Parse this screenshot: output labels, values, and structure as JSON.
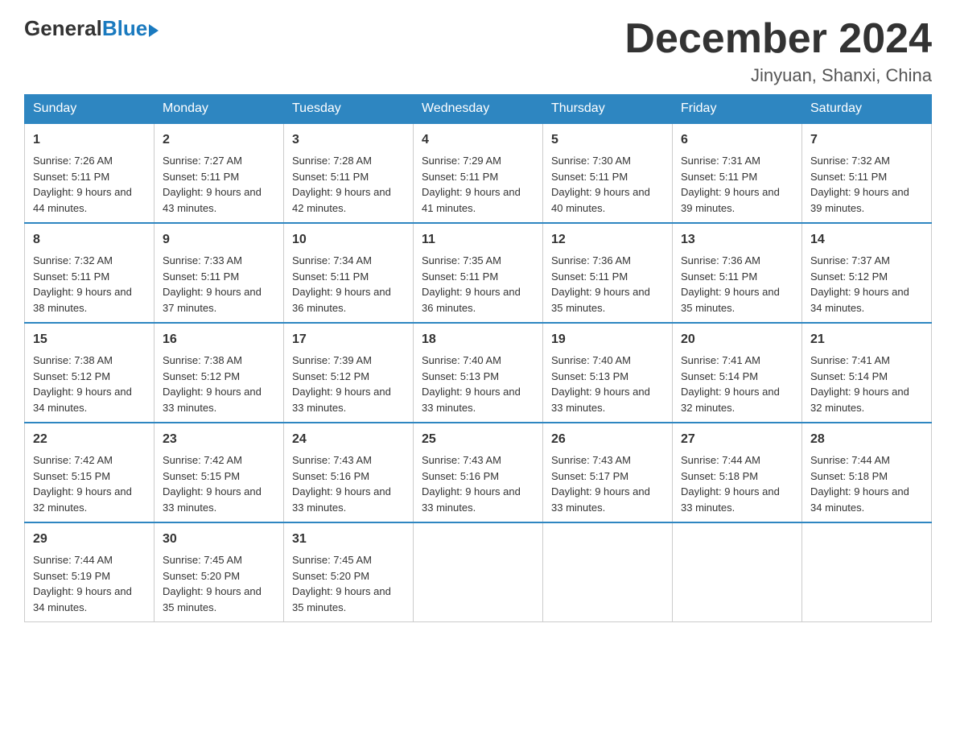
{
  "logo": {
    "general": "General",
    "blue": "Blue"
  },
  "title": "December 2024",
  "subtitle": "Jinyuan, Shanxi, China",
  "days": [
    "Sunday",
    "Monday",
    "Tuesday",
    "Wednesday",
    "Thursday",
    "Friday",
    "Saturday"
  ],
  "weeks": [
    [
      {
        "num": "1",
        "sunrise": "7:26 AM",
        "sunset": "5:11 PM",
        "daylight": "9 hours and 44 minutes."
      },
      {
        "num": "2",
        "sunrise": "7:27 AM",
        "sunset": "5:11 PM",
        "daylight": "9 hours and 43 minutes."
      },
      {
        "num": "3",
        "sunrise": "7:28 AM",
        "sunset": "5:11 PM",
        "daylight": "9 hours and 42 minutes."
      },
      {
        "num": "4",
        "sunrise": "7:29 AM",
        "sunset": "5:11 PM",
        "daylight": "9 hours and 41 minutes."
      },
      {
        "num": "5",
        "sunrise": "7:30 AM",
        "sunset": "5:11 PM",
        "daylight": "9 hours and 40 minutes."
      },
      {
        "num": "6",
        "sunrise": "7:31 AM",
        "sunset": "5:11 PM",
        "daylight": "9 hours and 39 minutes."
      },
      {
        "num": "7",
        "sunrise": "7:32 AM",
        "sunset": "5:11 PM",
        "daylight": "9 hours and 39 minutes."
      }
    ],
    [
      {
        "num": "8",
        "sunrise": "7:32 AM",
        "sunset": "5:11 PM",
        "daylight": "9 hours and 38 minutes."
      },
      {
        "num": "9",
        "sunrise": "7:33 AM",
        "sunset": "5:11 PM",
        "daylight": "9 hours and 37 minutes."
      },
      {
        "num": "10",
        "sunrise": "7:34 AM",
        "sunset": "5:11 PM",
        "daylight": "9 hours and 36 minutes."
      },
      {
        "num": "11",
        "sunrise": "7:35 AM",
        "sunset": "5:11 PM",
        "daylight": "9 hours and 36 minutes."
      },
      {
        "num": "12",
        "sunrise": "7:36 AM",
        "sunset": "5:11 PM",
        "daylight": "9 hours and 35 minutes."
      },
      {
        "num": "13",
        "sunrise": "7:36 AM",
        "sunset": "5:11 PM",
        "daylight": "9 hours and 35 minutes."
      },
      {
        "num": "14",
        "sunrise": "7:37 AM",
        "sunset": "5:12 PM",
        "daylight": "9 hours and 34 minutes."
      }
    ],
    [
      {
        "num": "15",
        "sunrise": "7:38 AM",
        "sunset": "5:12 PM",
        "daylight": "9 hours and 34 minutes."
      },
      {
        "num": "16",
        "sunrise": "7:38 AM",
        "sunset": "5:12 PM",
        "daylight": "9 hours and 33 minutes."
      },
      {
        "num": "17",
        "sunrise": "7:39 AM",
        "sunset": "5:12 PM",
        "daylight": "9 hours and 33 minutes."
      },
      {
        "num": "18",
        "sunrise": "7:40 AM",
        "sunset": "5:13 PM",
        "daylight": "9 hours and 33 minutes."
      },
      {
        "num": "19",
        "sunrise": "7:40 AM",
        "sunset": "5:13 PM",
        "daylight": "9 hours and 33 minutes."
      },
      {
        "num": "20",
        "sunrise": "7:41 AM",
        "sunset": "5:14 PM",
        "daylight": "9 hours and 32 minutes."
      },
      {
        "num": "21",
        "sunrise": "7:41 AM",
        "sunset": "5:14 PM",
        "daylight": "9 hours and 32 minutes."
      }
    ],
    [
      {
        "num": "22",
        "sunrise": "7:42 AM",
        "sunset": "5:15 PM",
        "daylight": "9 hours and 32 minutes."
      },
      {
        "num": "23",
        "sunrise": "7:42 AM",
        "sunset": "5:15 PM",
        "daylight": "9 hours and 33 minutes."
      },
      {
        "num": "24",
        "sunrise": "7:43 AM",
        "sunset": "5:16 PM",
        "daylight": "9 hours and 33 minutes."
      },
      {
        "num": "25",
        "sunrise": "7:43 AM",
        "sunset": "5:16 PM",
        "daylight": "9 hours and 33 minutes."
      },
      {
        "num": "26",
        "sunrise": "7:43 AM",
        "sunset": "5:17 PM",
        "daylight": "9 hours and 33 minutes."
      },
      {
        "num": "27",
        "sunrise": "7:44 AM",
        "sunset": "5:18 PM",
        "daylight": "9 hours and 33 minutes."
      },
      {
        "num": "28",
        "sunrise": "7:44 AM",
        "sunset": "5:18 PM",
        "daylight": "9 hours and 34 minutes."
      }
    ],
    [
      {
        "num": "29",
        "sunrise": "7:44 AM",
        "sunset": "5:19 PM",
        "daylight": "9 hours and 34 minutes."
      },
      {
        "num": "30",
        "sunrise": "7:45 AM",
        "sunset": "5:20 PM",
        "daylight": "9 hours and 35 minutes."
      },
      {
        "num": "31",
        "sunrise": "7:45 AM",
        "sunset": "5:20 PM",
        "daylight": "9 hours and 35 minutes."
      },
      null,
      null,
      null,
      null
    ]
  ]
}
